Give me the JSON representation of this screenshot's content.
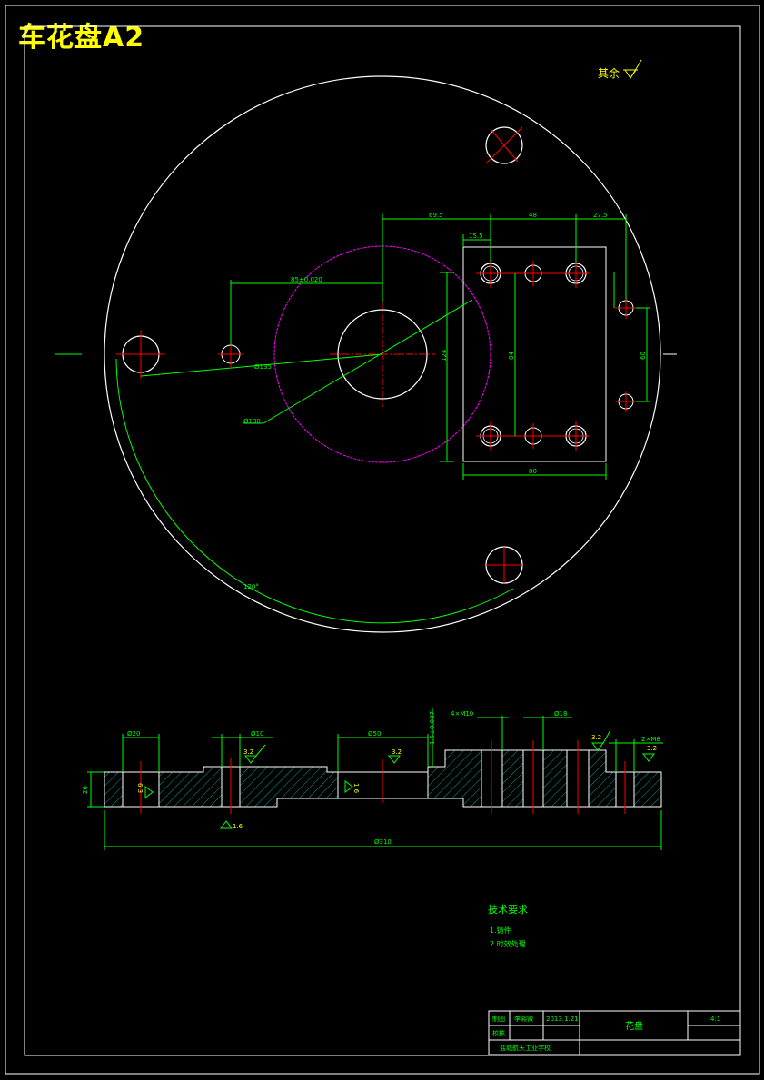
{
  "title": "车花盘A2",
  "roughness_note": "其余",
  "dims": {
    "d_69_5": "69.5",
    "d_48": "48",
    "d_27_5": "27.5",
    "d_15_5": "15.5",
    "d_85_tol": "85±0.020",
    "d_phi135": "Ø135",
    "d_phi130": "Ø130",
    "d_124": "124",
    "d_80": "80",
    "d_60": "60",
    "d_84": "84",
    "d_angle": "120°",
    "d_phi20": "Ø20",
    "d_phi10a": "Ø10",
    "d_phi50": "Ø50",
    "d_4xm10": "4×M10",
    "d_phi18": "Ø18",
    "d_2xm8": "2×M8",
    "d_1_5_tol": "1.5±0.087",
    "d_26": "26",
    "d_total": "Ø310",
    "r_3_2a": "3.2",
    "r_3_2b": "3.2",
    "r_3_2c": "3.2",
    "r_3_2d": "3.2",
    "r_1_6a": "1.6",
    "r_1_6b": "1.6",
    "r_6_3": "6.3"
  },
  "tech": {
    "heading": "技术要求",
    "item1": "1.铸件",
    "item2": "2.时效处理"
  },
  "title_block": {
    "drawn_label": "制图",
    "drawn_name": "李熙微",
    "drawn_date": "2013.1.21",
    "check_label": "校核",
    "part_name": "花盘",
    "scale": "4:1",
    "school": "盐城航天工业学校"
  }
}
